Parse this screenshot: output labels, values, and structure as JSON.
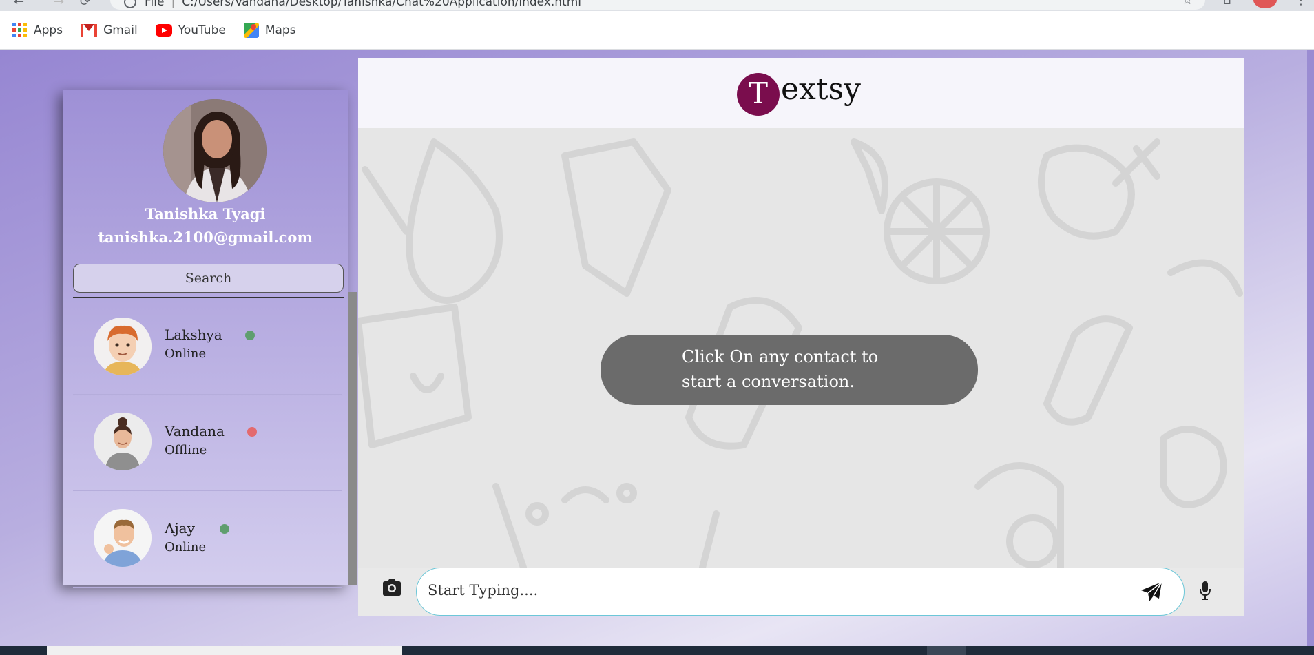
{
  "browser": {
    "url_label": "File",
    "url": "C:/Users/Vandana/Desktop/Tanishka/Chat%20Application/index.html",
    "bookmarks": [
      {
        "label": "Apps",
        "icon": "apps-grid-icon"
      },
      {
        "label": "Gmail",
        "icon": "gmail-icon"
      },
      {
        "label": "YouTube",
        "icon": "youtube-icon"
      },
      {
        "label": "Maps",
        "icon": "maps-icon"
      }
    ]
  },
  "sidebar": {
    "profile": {
      "name": "Tanishka Tyagi",
      "email": "tanishka.2100@gmail.com"
    },
    "search_label": "Search",
    "contacts": [
      {
        "name": "Lakshya",
        "status": "Online",
        "status_color": "#5f9e6e"
      },
      {
        "name": "Vandana",
        "status": "Offline",
        "status_color": "#e36a6e"
      },
      {
        "name": "Ajay",
        "status": "Online",
        "status_color": "#5f9e6e"
      }
    ]
  },
  "chat": {
    "logo_initial": "T",
    "logo_rest": "extsy",
    "logo_color": "#7a0d4d",
    "prompt_line1": "Click On any contact to",
    "prompt_line2": "start a conversation.",
    "input_placeholder": "Start Typing...."
  }
}
